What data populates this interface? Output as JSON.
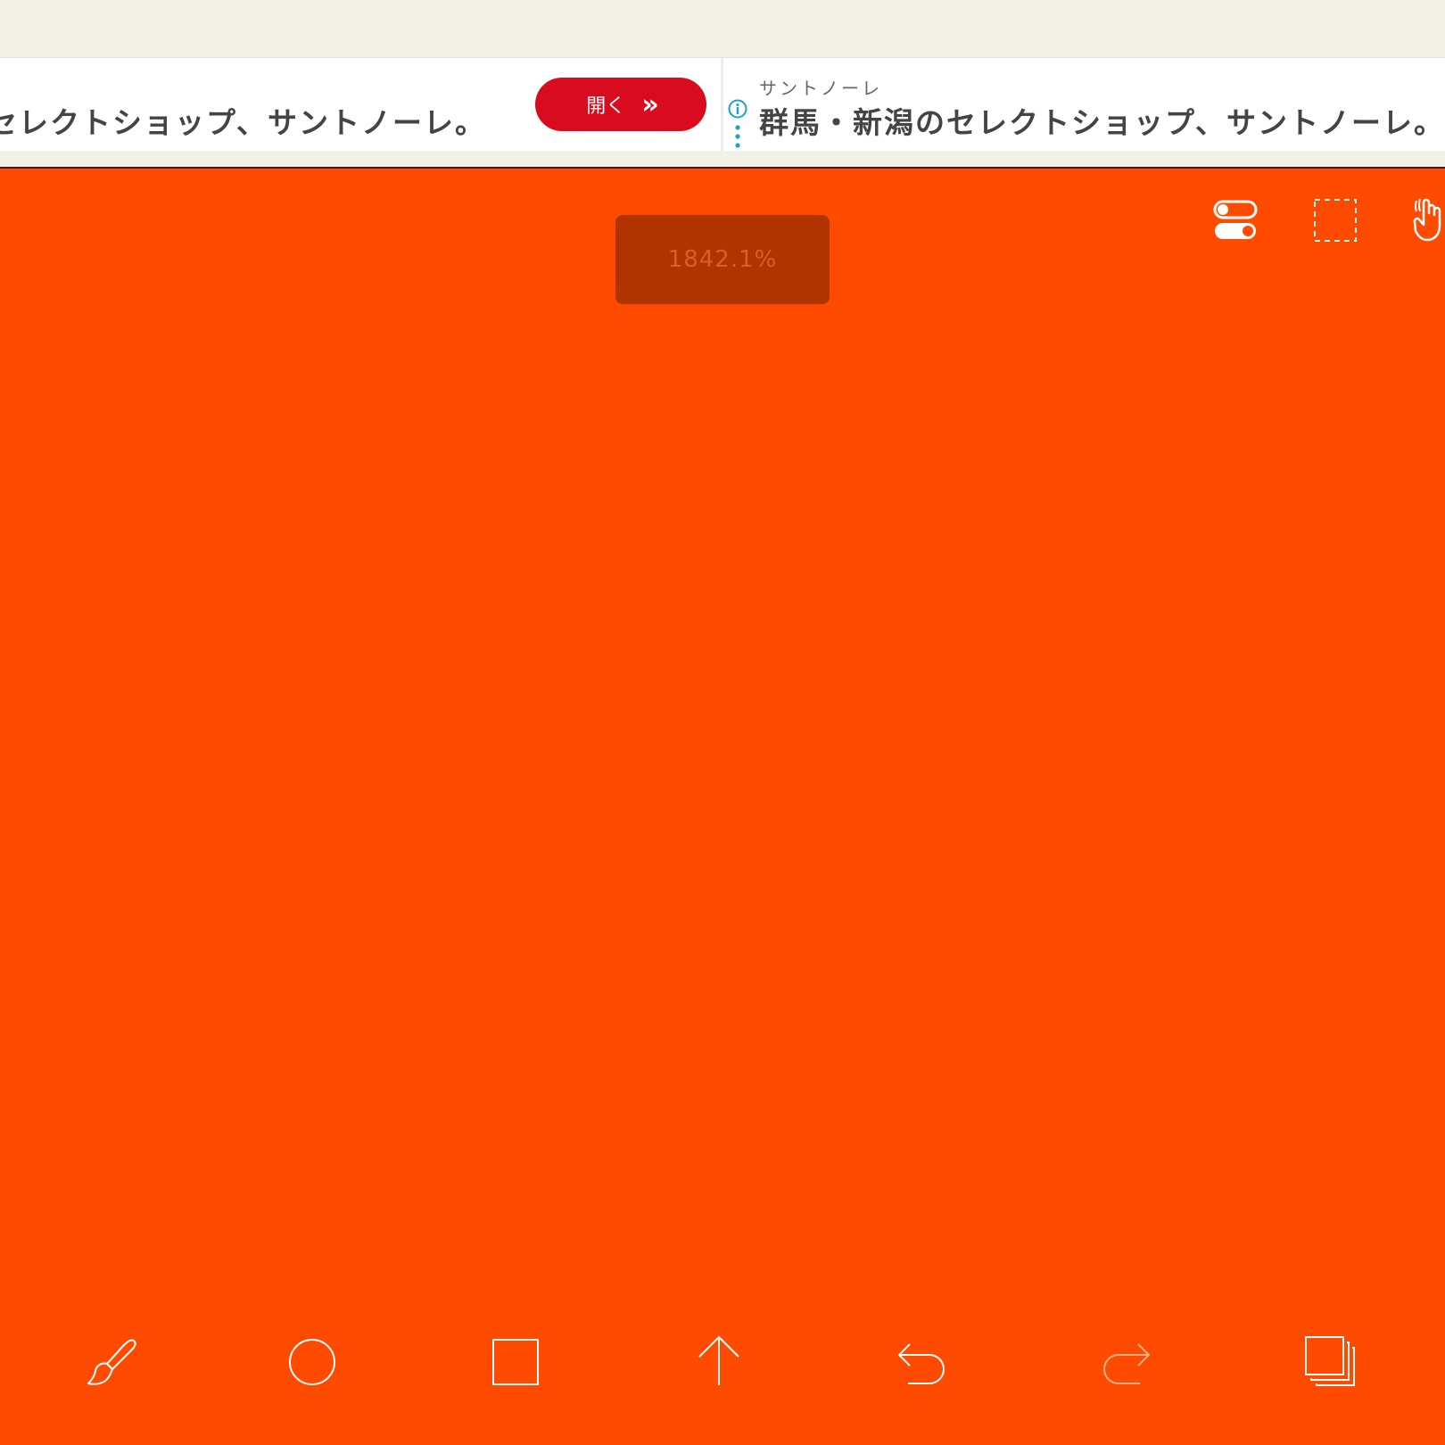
{
  "ad": {
    "left_text": "セレクトショップ、サントノーレ。",
    "open_label": "開く",
    "open_chevron": "»",
    "advertiser": "サントノーレ",
    "headline": "群馬・新潟のセレクトショップ、サントノーレ。",
    "icons": [
      "info-icon",
      "kebab-menu-icon"
    ],
    "accent_color": "#d90b1e"
  },
  "canvas": {
    "background_color": "#ff4b00",
    "zoom_level": "1842.1%"
  },
  "top_toolbar": {
    "icons": [
      "toggle-switches-icon",
      "marquee-select-icon",
      "hand-touch-icon"
    ]
  },
  "bottom_toolbar": {
    "icons": [
      "brush-icon",
      "circle-icon",
      "square-icon",
      "arrow-up-icon",
      "undo-icon",
      "redo-icon",
      "layers-icon"
    ]
  }
}
